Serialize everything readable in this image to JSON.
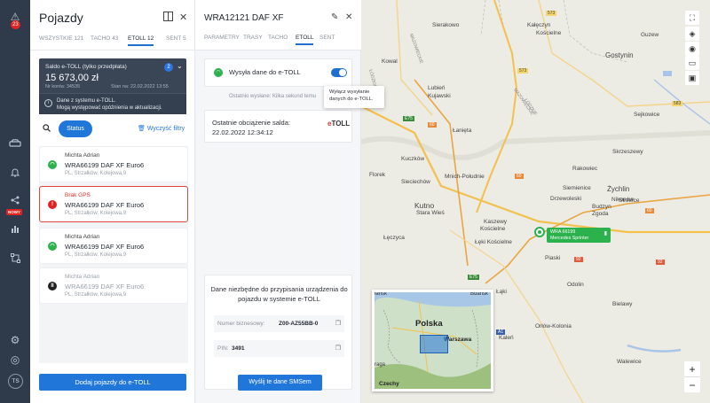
{
  "rail": {
    "alert_count": "23",
    "new_badge": "NOWY",
    "avatar": "TS"
  },
  "vehicles": {
    "title": "Pojazdy",
    "tabs": [
      {
        "label": "WSZYSTKIE",
        "count": "121"
      },
      {
        "label": "TACHO",
        "count": "43"
      },
      {
        "label": "ETOLL",
        "count": "12"
      },
      {
        "label": "SENT",
        "count": "5"
      }
    ],
    "saldo": {
      "label": "Saldo e-TOLL (tylko przedpłata)",
      "amount": "15 673,00 zł",
      "account": "Nr konta: 34535",
      "state": "Stan na: 22.02.2022 13:55",
      "count": "2",
      "warning_line1": "Dane z systemu e-TOLL.",
      "warning_line2": "Mogą występować opóźnienia w aktualizacji."
    },
    "status_button": "Status",
    "clear_filters": "Wyczyść filtry",
    "list": [
      {
        "driver": "Michta Adrian",
        "vehicle": "WRA66199 DAF XF Euro6",
        "address": "PL, Strzałków, Kolejowa,9",
        "status": "ok"
      },
      {
        "driver": "Brak GPS",
        "vehicle": "WRA66199 DAF XF Euro6",
        "address": "PL, Strzałków, Kolejowa,9",
        "status": "alert"
      },
      {
        "driver": "Michta Adrian",
        "vehicle": "WRA66199 DAF XF Euro6",
        "address": "PL, Strzałków, Kolejowa,9",
        "status": "ok"
      },
      {
        "driver": "Michta Adrian",
        "vehicle": "WRA66199 DAF XF Euro6",
        "address": "PL, Strzałków, Kolejowa,9",
        "status": "paused"
      }
    ],
    "add_button": "Dodaj pojazdy do e-TOLL"
  },
  "detail": {
    "title": "WRA12121 DAF XF",
    "tabs": [
      "PARAMETRY",
      "TRASY",
      "TACHO",
      "ETOLL",
      "SENT"
    ],
    "send_label": "Wysyła dane do e-TOLL",
    "last_sent": "Ostatnio wysłane:  Kilka sekund temu",
    "tooltip": "Wyłącz wysyłanie danych do e-TOLL.",
    "last_charge_label": "Ostatnie obciążenie salda:",
    "last_charge_date": "22.02.2022 12:34:12",
    "logo": "eTOLL",
    "pairing_text": "Dane niezbędne do przypisania urządzenia do pojazdu w systemie e-TOLL",
    "business_label": "Numer biznesowy:",
    "business_value": "Z00-AZ55BB-0",
    "pin_label": "PIN:",
    "pin_value": "3491",
    "sms_button": "Wyślij te dane SMSem"
  },
  "map": {
    "vehicle_label_1": "WRA 66199",
    "vehicle_label_2": "Mercedes Sprinter",
    "minimap_country": "Polska",
    "minimap_city": "Warszawa",
    "minimap_prague": "raga",
    "minimap_czechy": "Czechy",
    "places": [
      "Sierakowo",
      "Kałęczyn",
      "Kościelne",
      "Guzew",
      "Gostynin",
      "Kowal",
      "Lubień",
      "Kujawski",
      "Sejkowice",
      "Łanięta",
      "Skrzeszewy",
      "Kuczków",
      "Rakowiec",
      "Siemienice",
      "Sieciechów",
      "Żychlin",
      "Florek",
      "Drzewoleski",
      "Nikonów",
      "Kutno",
      "Strzelce",
      "Mnich-Południe",
      "Zgoda",
      "Budzyn",
      "Stara Wieś",
      "Kaszewy",
      "Kościelne",
      "Łęczyca",
      "Łęki Kościelne",
      "Bielawy",
      "Orłów-Kolonia",
      "Odolin",
      "Walewice",
      "Łąki",
      "Kaleń",
      "Piaski"
    ],
    "roads": [
      "573",
      "573",
      "583",
      "60",
      "60",
      "60",
      "E75",
      "E75",
      "92",
      "92",
      "A1"
    ],
    "region_labels": [
      "MAZOWIECKIE",
      "ŁÓDZKIE"
    ],
    "minimap_labels": [
      "Dańsk",
      "Bdańsk"
    ],
    "zoom_in": "+",
    "zoom_out": "−"
  }
}
